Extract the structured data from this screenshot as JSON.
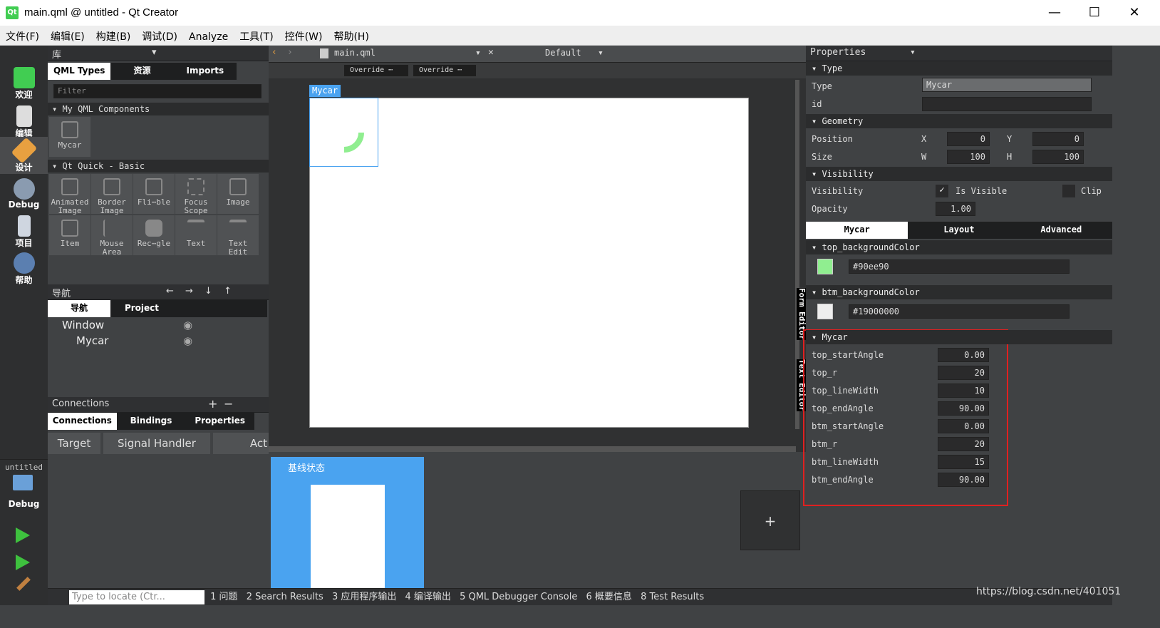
{
  "window": {
    "title": "main.qml @ untitled - Qt Creator",
    "logo": "Qt"
  },
  "menu": [
    "文件(F)",
    "编辑(E)",
    "构建(B)",
    "调试(D)",
    "Analyze",
    "工具(T)",
    "控件(W)",
    "帮助(H)"
  ],
  "modes": [
    {
      "label": "欢迎"
    },
    {
      "label": "编辑"
    },
    {
      "label": "设计"
    },
    {
      "label": "Debug"
    },
    {
      "label": "项目"
    },
    {
      "label": "帮助"
    }
  ],
  "kit": {
    "project": "untitled",
    "config": "Debug"
  },
  "library": {
    "title": "库",
    "tabs": [
      "QML Types",
      "资源",
      "Imports"
    ],
    "filter_placeholder": "Filter",
    "sec1": "My QML Components",
    "my_components": [
      "Mycar"
    ],
    "sec2": "Qt Quick - Basic",
    "basic": [
      "Animated Image",
      "Border Image",
      "Fli⋯ble",
      "Focus Scope",
      "Image",
      "Item",
      "Mouse Area",
      "Rec⋯gle",
      "Text",
      "Text Edit"
    ]
  },
  "navigator": {
    "title": "导航",
    "tabs": [
      "导航",
      "Project"
    ],
    "items": [
      "Window",
      "Mycar"
    ]
  },
  "connections": {
    "title": "Connections",
    "tabs": [
      "Connections",
      "Bindings",
      "Properties"
    ],
    "columns": [
      "Target",
      "Signal Handler",
      "Act"
    ]
  },
  "editor": {
    "file": "main.qml",
    "config": "Default",
    "override1": "Override ⋯",
    "override2": "Override ⋯",
    "selected": "Mycar",
    "side_tab1": "Form Editor",
    "side_tab2": "Text Editor",
    "state_label": "基线状态",
    "add_state": "+"
  },
  "properties": {
    "title": "Properties",
    "type_sec": "Type",
    "type_label": "Type",
    "type_value": "Mycar",
    "id_label": "id",
    "id_value": "",
    "geometry_sec": "Geometry",
    "position_label": "Position",
    "x_label": "X",
    "x": "0",
    "y_label": "Y",
    "y": "0",
    "size_label": "Size",
    "w_label": "W",
    "w": "100",
    "h_label": "H",
    "h": "100",
    "visibility_sec": "Visibility",
    "visibility_label": "Visibility",
    "is_visible": "Is Visible",
    "clip": "Clip",
    "opacity_label": "Opacity",
    "opacity": "1.00",
    "tabs": [
      "Mycar",
      "Layout",
      "Advanced"
    ],
    "top_bg_sec": "top_backgroundColor",
    "top_bg": "#90ee90",
    "btm_bg_sec": "btm_backgroundColor",
    "btm_bg": "#19000000",
    "mycar_sec": "Mycar",
    "mycar_props": [
      {
        "name": "top_startAngle",
        "value": "0.00"
      },
      {
        "name": "top_r",
        "value": "20"
      },
      {
        "name": "top_lineWidth",
        "value": "10"
      },
      {
        "name": "top_endAngle",
        "value": "90.00"
      },
      {
        "name": "btm_startAngle",
        "value": "0.00"
      },
      {
        "name": "btm_r",
        "value": "20"
      },
      {
        "name": "btm_lineWidth",
        "value": "15"
      },
      {
        "name": "btm_endAngle",
        "value": "90.00"
      }
    ]
  },
  "status": {
    "locate_placeholder": "Type to locate (Ctr...",
    "panes": [
      "1 问题",
      "2 Search Results",
      "3 应用程序输出",
      "4 编译输出",
      "5 QML Debugger Console",
      "6 概要信息",
      "8 Test Results"
    ],
    "watermark": "https://blog.csdn.net/401051"
  }
}
